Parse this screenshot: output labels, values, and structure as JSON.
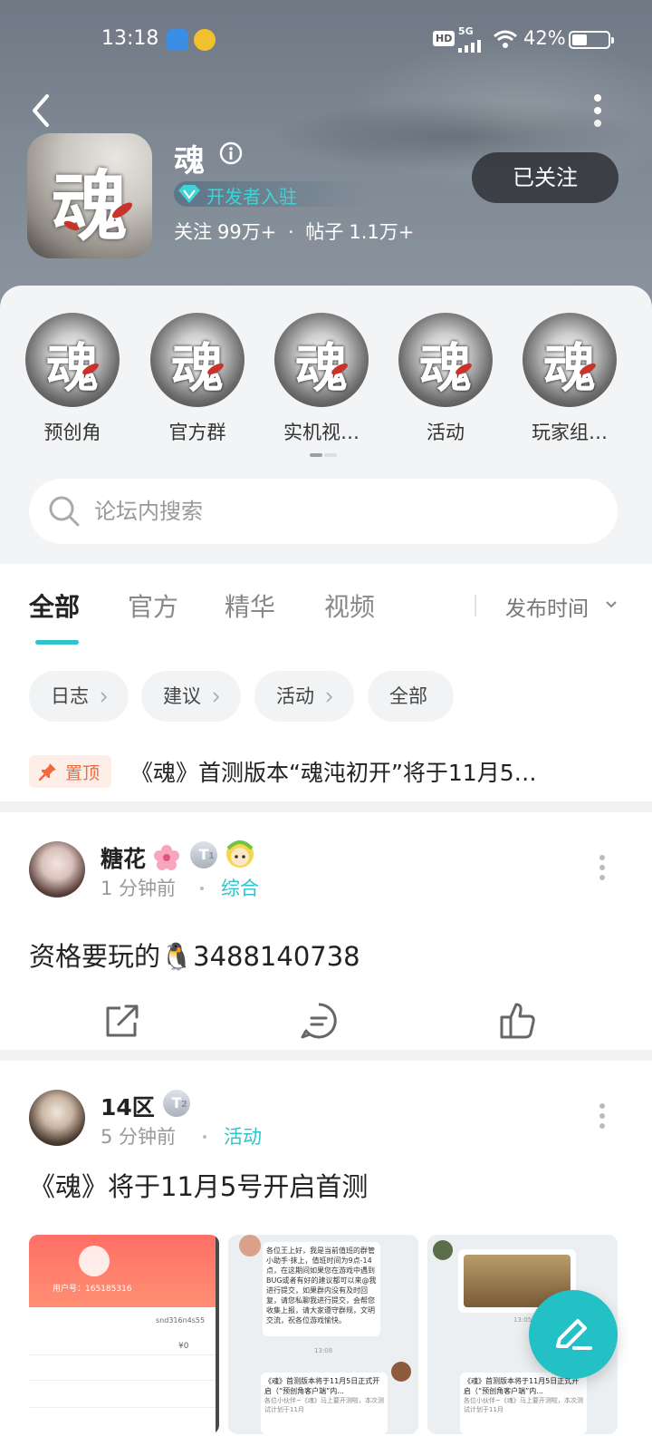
{
  "status_bar": {
    "time": "13:18",
    "network": "5G",
    "hd": "HD",
    "battery": "42%",
    "battery_level": 0.42
  },
  "header": {
    "title": "魂",
    "developer_badge": "开发者入驻",
    "follow_label": "关注",
    "follow_count": "99万+",
    "separator": "·",
    "posts_label": "帖子",
    "posts_count": "1.1万+",
    "follow_button": "已关注"
  },
  "icon_glyph": "魂",
  "quick_links": [
    {
      "label": "预创角"
    },
    {
      "label": "官方群"
    },
    {
      "label": "实机视…"
    },
    {
      "label": "活动"
    },
    {
      "label": "玩家组…"
    }
  ],
  "search": {
    "placeholder": "论坛内搜索"
  },
  "tabs": [
    {
      "label": "全部",
      "active": true
    },
    {
      "label": "官方",
      "active": false
    },
    {
      "label": "精华",
      "active": false
    },
    {
      "label": "视频",
      "active": false
    }
  ],
  "sort": {
    "label": "发布时间"
  },
  "chips": [
    {
      "label": "日志"
    },
    {
      "label": "建议"
    },
    {
      "label": "活动"
    },
    {
      "label": "全部"
    }
  ],
  "pinned": {
    "badge": "置顶",
    "title": "《魂》首测版本“魂沌初开”将于11月5…"
  },
  "posts": [
    {
      "user": "糖花",
      "time": "1 分钟前",
      "category": "综合",
      "badge": "T",
      "badge_level": "1",
      "body_text": "资格要玩的",
      "body_emoji": "🐧",
      "body_number": "3488140738"
    },
    {
      "user": "14区",
      "time": "5 分钟前",
      "category": "活动",
      "badge": "T",
      "badge_level": "2",
      "body_text": "《魂》将于11月5号开启首测"
    }
  ],
  "thumbnails": {
    "t1_user_id": "用户号：165185316",
    "t1_row1": "snd316n4s55",
    "t1_row2": "¥0",
    "t2_message": "各位王上好，我是当前值班的群管小助手·抹上，值班时间为9点-14点，在这期间如果您在游戏中遇到BUG或者有好的建议都可以来@我进行提交，如果群内没有及时回复，请您私聊我进行提交，会帮您收集上报，请大家遵守群规，文明交流，祝各位游戏愉快。",
    "t2_time": "13:08",
    "t2_card": "《魂》首测版本将于11月5日正式开启（“预创角客户端”内...",
    "t2_card_sub": "各位小伙伴~《魂》马上要开测啦，本次测试计划于11月",
    "t3_time": "13:05",
    "t3_card": "《魂》首测版本将于11月5日正式开启（“预创角客户端”内...",
    "t3_card_sub": "各位小伙伴~《魂》马上要开测啦，本次测试计划于11月"
  },
  "colors": {
    "accent": "#23c0c6",
    "pin": "#f06a3d",
    "header_bg": "#7e8893"
  }
}
